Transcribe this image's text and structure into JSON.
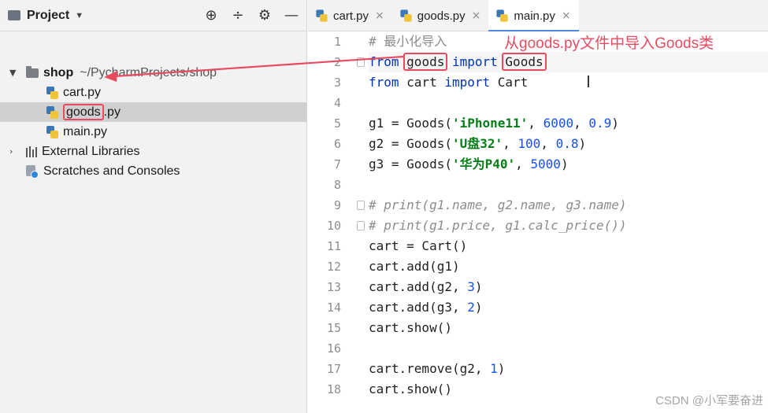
{
  "project_panel": {
    "title": "Project",
    "tools": {
      "locate": "⊕",
      "collapse": "÷",
      "settings": "⚙",
      "hide": "—"
    },
    "tree": {
      "root_name": "shop",
      "root_path": "~/PycharmProjects/shop",
      "files": [
        "cart.py",
        "goods",
        ".py",
        "main.py"
      ],
      "external_libraries": "External Libraries",
      "scratches": "Scratches and Consoles"
    }
  },
  "tabs": [
    {
      "label": "cart.py",
      "active": false
    },
    {
      "label": "goods.py",
      "active": false
    },
    {
      "label": "main.py",
      "active": true
    }
  ],
  "tab_close": "×",
  "editor": {
    "line_numbers": [
      "1",
      "2",
      "3",
      "4",
      "5",
      "6",
      "7",
      "8",
      "9",
      "10",
      "11",
      "12",
      "13",
      "14",
      "15",
      "16",
      "17",
      "18"
    ],
    "code": {
      "l1_comment": "# 最小化导入",
      "l2_from": "from",
      "l2_module": "goods",
      "l2_import": "import",
      "l2_class": "Goods",
      "l3": {
        "from": "from",
        "rest1": " cart ",
        "import": "import",
        "rest2": " Cart"
      },
      "l5": {
        "pre": "g1 = Goods(",
        "str": "'iPhone11'",
        "mid": ", ",
        "n1": "6000",
        "sep": ", ",
        "n2": "0.9",
        "end": ")"
      },
      "l6": {
        "pre": "g2 = Goods(",
        "str": "'U盘32'",
        "mid": ", ",
        "n1": "100",
        "sep": ", ",
        "n2": "0.8",
        "end": ")"
      },
      "l7": {
        "pre": "g3 = Goods(",
        "str": "'华为P40'",
        "mid": ", ",
        "n1": "5000",
        "end": ")"
      },
      "l9": "# print(g1.name, g2.name, g3.name)",
      "l10": "# print(g1.price, g1.calc_price())",
      "l11": "cart = Cart()",
      "l12": "cart.add(g1)",
      "l13": {
        "pre": "cart.add(g2, ",
        "n": "3",
        "end": ")"
      },
      "l14": {
        "pre": "cart.add(g3, ",
        "n": "2",
        "end": ")"
      },
      "l15": "cart.show()",
      "l17": {
        "pre": "cart.remove(g2, ",
        "n": "1",
        "end": ")"
      },
      "l18": "cart.show()"
    },
    "text_cursor": "I"
  },
  "annotation": "从goods.py文件中导入Goods类",
  "watermark": "CSDN @小军要奋进",
  "colors": {
    "annotation": "#e84a5f",
    "keyword": "#0033b3",
    "string": "#067d17",
    "number": "#1750eb",
    "tab_accent": "#4a86e8"
  }
}
